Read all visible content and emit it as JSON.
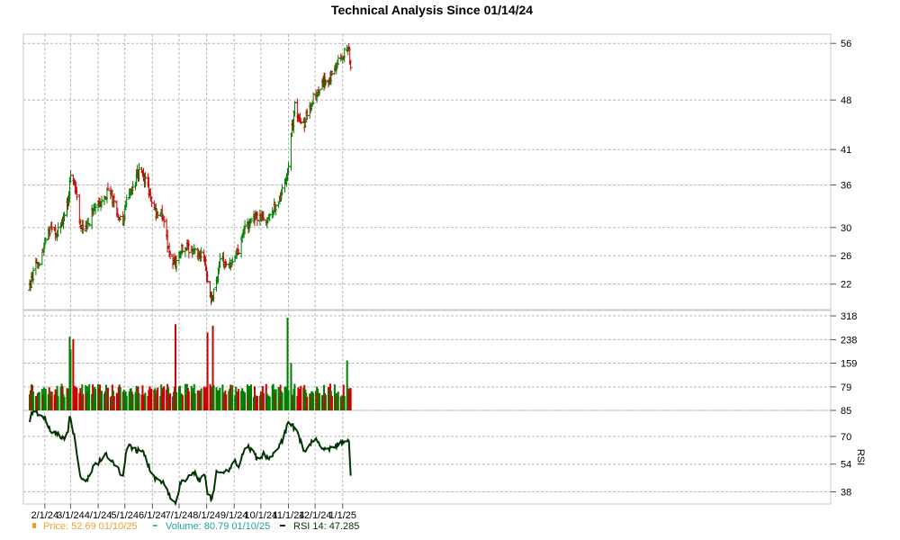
{
  "chart_data": {
    "type": "line",
    "title": "Technical Analysis Since 01/14/24",
    "x_tick_labels": [
      "2/1/24",
      "3/1/24",
      "4/1/24",
      "5/1/24",
      "6/1/24",
      "7/1/24",
      "8/1/24",
      "9/1/24",
      "10/1/24",
      "11/1/24",
      "12/1/24",
      "1/1/25"
    ],
    "price": {
      "y_ticks": [
        "56",
        "48",
        "41",
        "36",
        "30",
        "26",
        "22"
      ],
      "ylim": [
        18.4,
        57.3
      ],
      "grid": true,
      "keys": [
        [
          "2024-01-14",
          21
        ],
        [
          "2024-01-20",
          24
        ],
        [
          "2024-01-26",
          25
        ],
        [
          "2024-02-02",
          29
        ],
        [
          "2024-02-07",
          29.5
        ],
        [
          "2024-02-14",
          29
        ],
        [
          "2024-02-21",
          31
        ],
        [
          "2024-02-27",
          34
        ],
        [
          "2024-03-01",
          37
        ],
        [
          "2024-03-07",
          35
        ],
        [
          "2024-03-12",
          30
        ],
        [
          "2024-03-18",
          29.5
        ],
        [
          "2024-03-25",
          32
        ],
        [
          "2024-04-01",
          33
        ],
        [
          "2024-04-08",
          34.5
        ],
        [
          "2024-04-15",
          35
        ],
        [
          "2024-04-22",
          32
        ],
        [
          "2024-04-29",
          30.5
        ],
        [
          "2024-05-06",
          35.5
        ],
        [
          "2024-05-10",
          36
        ],
        [
          "2024-05-15",
          37.5
        ],
        [
          "2024-05-22",
          37.5
        ],
        [
          "2024-05-28",
          35
        ],
        [
          "2024-06-04",
          32
        ],
        [
          "2024-06-10",
          32
        ],
        [
          "2024-06-14",
          31
        ],
        [
          "2024-06-20",
          26
        ],
        [
          "2024-06-27",
          24.5
        ],
        [
          "2024-07-03",
          27
        ],
        [
          "2024-07-10",
          27
        ],
        [
          "2024-07-17",
          27
        ],
        [
          "2024-07-24",
          26
        ],
        [
          "2024-07-30",
          26
        ],
        [
          "2024-08-02",
          22
        ],
        [
          "2024-08-06",
          20
        ],
        [
          "2024-08-12",
          22
        ],
        [
          "2024-08-16",
          25
        ],
        [
          "2024-08-23",
          25
        ],
        [
          "2024-08-29",
          24.5
        ],
        [
          "2024-09-05",
          26.5
        ],
        [
          "2024-09-12",
          30
        ],
        [
          "2024-09-18",
          30.5
        ],
        [
          "2024-09-24",
          31.5
        ],
        [
          "2024-10-01",
          32
        ],
        [
          "2024-10-07",
          31
        ],
        [
          "2024-10-14",
          32
        ],
        [
          "2024-10-21",
          34
        ],
        [
          "2024-10-25",
          35
        ],
        [
          "2024-10-31",
          38
        ],
        [
          "2024-11-05",
          44
        ],
        [
          "2024-11-08",
          47
        ],
        [
          "2024-11-13",
          45
        ],
        [
          "2024-11-19",
          45
        ],
        [
          "2024-11-25",
          47
        ],
        [
          "2024-12-01",
          49
        ],
        [
          "2024-12-08",
          50
        ],
        [
          "2024-12-15",
          51
        ],
        [
          "2024-12-22",
          52
        ],
        [
          "2024-12-29",
          54
        ],
        [
          "2025-01-04",
          55
        ],
        [
          "2025-01-08",
          55
        ],
        [
          "2025-01-10",
          52.7
        ]
      ]
    },
    "volume": {
      "y_ticks": [
        "318",
        "238",
        "159",
        "79"
      ],
      "ylim": [
        0,
        318
      ],
      "grid": true,
      "spikes": [
        [
          "2024-02-29",
          248
        ],
        [
          "2024-03-01",
          205
        ],
        [
          "2024-03-04",
          240
        ],
        [
          "2024-06-27",
          290
        ],
        [
          "2024-08-02",
          262
        ],
        [
          "2024-08-08",
          285
        ],
        [
          "2024-10-31",
          312
        ],
        [
          "2024-11-04",
          160
        ],
        [
          "2025-01-06",
          168
        ]
      ]
    },
    "rsi": {
      "label": "RSI",
      "y_ticks": [
        "85",
        "70",
        "54",
        "38"
      ],
      "ylim": [
        31,
        85
      ],
      "grid": true,
      "keys": [
        [
          "2024-01-14",
          78
        ],
        [
          "2024-01-18",
          84
        ],
        [
          "2024-01-25",
          83
        ],
        [
          "2024-02-02",
          80
        ],
        [
          "2024-02-08",
          72
        ],
        [
          "2024-02-15",
          72
        ],
        [
          "2024-02-22",
          68
        ],
        [
          "2024-02-27",
          74
        ],
        [
          "2024-02-29",
          82
        ],
        [
          "2024-03-05",
          70
        ],
        [
          "2024-03-12",
          47
        ],
        [
          "2024-03-18",
          44
        ],
        [
          "2024-03-25",
          51
        ],
        [
          "2024-04-01",
          55
        ],
        [
          "2024-04-08",
          60
        ],
        [
          "2024-04-15",
          57
        ],
        [
          "2024-04-22",
          53
        ],
        [
          "2024-04-29",
          46
        ],
        [
          "2024-05-03",
          62
        ],
        [
          "2024-05-07",
          66
        ],
        [
          "2024-05-10",
          62
        ],
        [
          "2024-05-15",
          62
        ],
        [
          "2024-05-22",
          61
        ],
        [
          "2024-05-28",
          52
        ],
        [
          "2024-06-04",
          45
        ],
        [
          "2024-06-10",
          44
        ],
        [
          "2024-06-15",
          42
        ],
        [
          "2024-06-20",
          36
        ],
        [
          "2024-06-27",
          32
        ],
        [
          "2024-07-03",
          44
        ],
        [
          "2024-07-10",
          46
        ],
        [
          "2024-07-17",
          50
        ],
        [
          "2024-07-24",
          45
        ],
        [
          "2024-07-30",
          47
        ],
        [
          "2024-08-02",
          38
        ],
        [
          "2024-08-07",
          33
        ],
        [
          "2024-08-12",
          50
        ],
        [
          "2024-08-19",
          50
        ],
        [
          "2024-08-26",
          50
        ],
        [
          "2024-09-02",
          56
        ],
        [
          "2024-09-06",
          51
        ],
        [
          "2024-09-10",
          60
        ],
        [
          "2024-09-16",
          64
        ],
        [
          "2024-09-22",
          61
        ],
        [
          "2024-09-28",
          56
        ],
        [
          "2024-10-04",
          60
        ],
        [
          "2024-10-10",
          57
        ],
        [
          "2024-10-18",
          62
        ],
        [
          "2024-10-25",
          67
        ],
        [
          "2024-11-01",
          78
        ],
        [
          "2024-11-06",
          76
        ],
        [
          "2024-11-12",
          72
        ],
        [
          "2024-11-18",
          61
        ],
        [
          "2024-11-25",
          65
        ],
        [
          "2024-12-02",
          70
        ],
        [
          "2024-12-08",
          64
        ],
        [
          "2024-12-15",
          63
        ],
        [
          "2024-12-22",
          64
        ],
        [
          "2024-12-29",
          66
        ],
        [
          "2025-01-04",
          68
        ],
        [
          "2025-01-08",
          67
        ],
        [
          "2025-01-10",
          47.3
        ]
      ]
    },
    "colors": {
      "up": "#008000",
      "down": "#cc0000",
      "rsi_line": "#003300",
      "price_legend": "#f0a030",
      "volume_legend": "#20a0a0"
    },
    "legend": [
      {
        "text": "Price: 52.69  01/10/25",
        "color": "#f0a030",
        "marker": "square"
      },
      {
        "text": "Volume: 80.79  01/10/25",
        "color": "#20a0a0",
        "marker": "dash"
      },
      {
        "text": "RSI 14: 47.285",
        "color": "#003300",
        "marker": "line"
      }
    ]
  }
}
